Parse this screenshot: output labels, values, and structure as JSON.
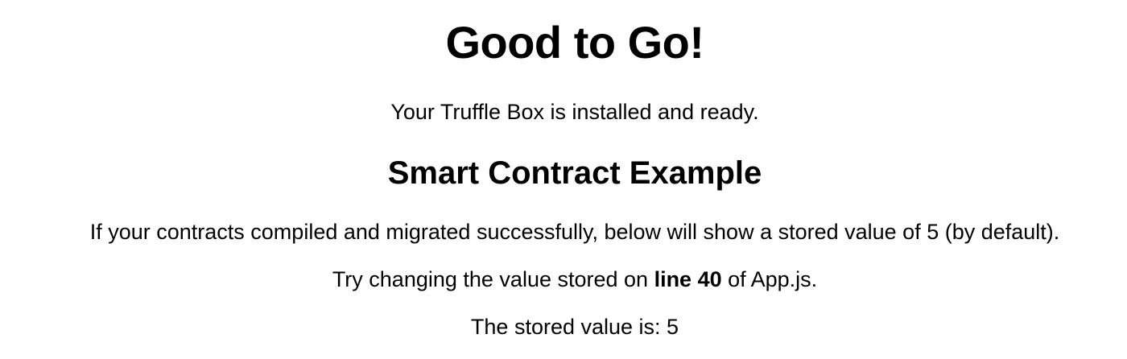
{
  "page": {
    "title": "Good to Go!",
    "intro": "Your Truffle Box is installed and ready.",
    "section_heading": "Smart Contract Example",
    "description": "If your contracts compiled and migrated successfully, below will show a stored value of 5 (by default).",
    "hint": {
      "prefix": "Try changing the value stored on ",
      "emphasis": "line 40",
      "suffix": " of App.js."
    },
    "stored_value": {
      "label": "The stored value is: ",
      "value": "5"
    }
  }
}
